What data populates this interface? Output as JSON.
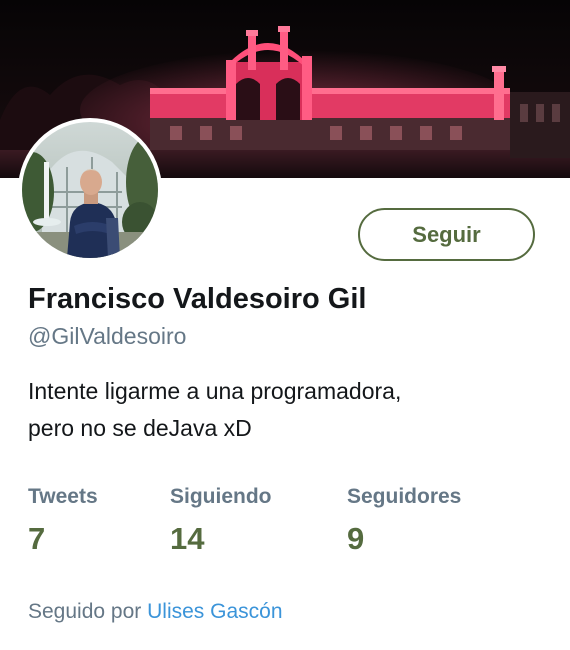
{
  "profile": {
    "name": "Francisco Valdesoiro Gil",
    "handle": "@GilValdesoiro",
    "bio_lines": [
      "Intente ligarme a una programadora,",
      "pero no se deJava xD"
    ],
    "follow_label": "Seguir"
  },
  "stats": [
    {
      "label": "Tweets",
      "value": "7"
    },
    {
      "label": "Siguiendo",
      "value": "14"
    },
    {
      "label": "Seguidores",
      "value": "9"
    }
  ],
  "followed_by": {
    "prefix": "Seguido por",
    "user": "Ulises Gascón"
  },
  "colors": {
    "accent": "#556b3f",
    "secondary_text": "#657786",
    "link": "#3b94d9",
    "banner_light": "#e8345f"
  }
}
